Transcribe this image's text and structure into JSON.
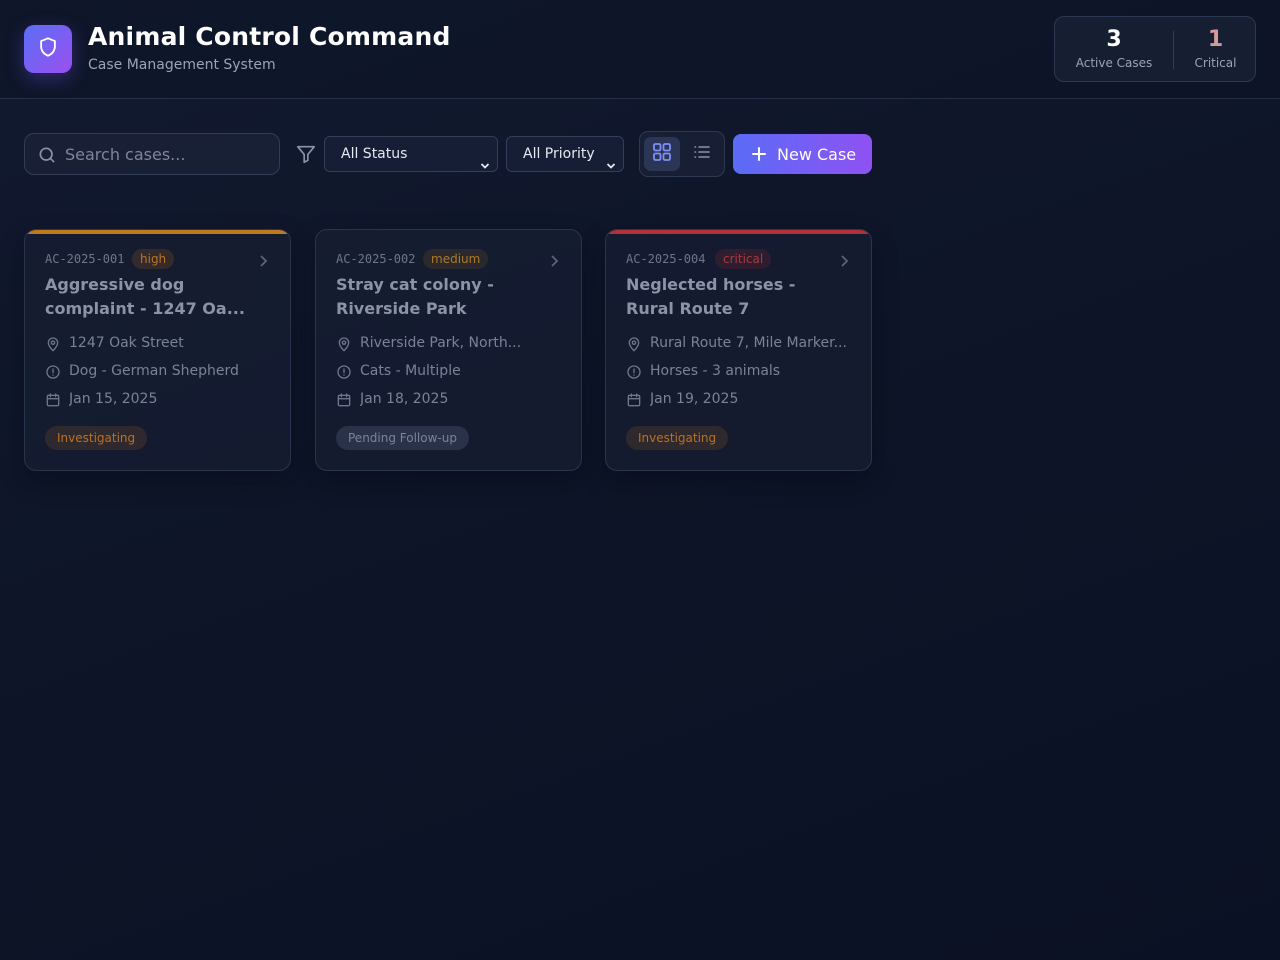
{
  "app": {
    "title": "Animal Control Command",
    "subtitle": "Case Management System",
    "logo_icon": "shield-icon",
    "accent": "#6c5cf3"
  },
  "stats": [
    {
      "value": "3",
      "label": "Active Cases"
    },
    {
      "value": "1",
      "label": "Critical"
    }
  ],
  "toolbar": {
    "search_placeholder": "Search cases...",
    "status_filter": "All Status",
    "priority_filter": "All Priority",
    "view_mode": "grid",
    "new_case_label": "New Case"
  },
  "cases": [
    {
      "id": "AC-2025-001",
      "priority": "high",
      "title_line1": "Aggressive dog",
      "title_line2": "complaint - 1247 Oa...",
      "location": "1247 Oak Street",
      "animal": "Dog - German Shepherd",
      "date": "Jan 15, 2025",
      "status": "Investigating",
      "accent": "#c07a1e"
    },
    {
      "id": "AC-2025-002",
      "priority": "medium",
      "title_line1": "Stray cat colony -",
      "title_line2": "Riverside Park",
      "location": "Riverside Park, North...",
      "animal": "Cats - Multiple",
      "date": "Jan 18, 2025",
      "status": "Pending Follow-up",
      "accent": ""
    },
    {
      "id": "AC-2025-004",
      "priority": "critical",
      "title_line1": "Neglected horses -",
      "title_line2": "Rural Route 7",
      "location": "Rural Route 7, Mile Marker...",
      "animal": "Horses - 3 animals",
      "date": "Jan 19, 2025",
      "status": "Investigating",
      "accent": "#b0323a"
    }
  ]
}
